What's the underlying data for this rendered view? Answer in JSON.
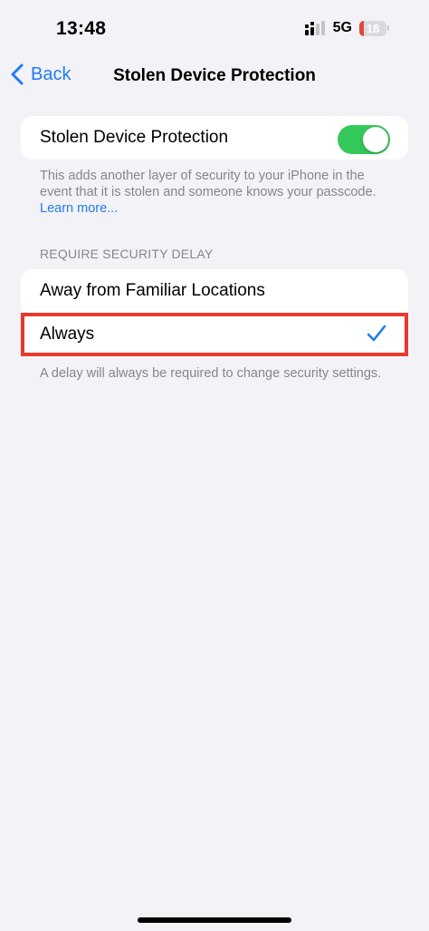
{
  "status_bar": {
    "time": "13:48",
    "network": "5G",
    "battery_level": "18",
    "battery_fraction": 0.18,
    "signal_icon": "signal-bars-icon"
  },
  "nav": {
    "back_label": "Back",
    "title": "Stolen Device Protection"
  },
  "protection": {
    "toggle_label": "Stolen Device Protection",
    "toggle_on": true,
    "description": "This adds another layer of security to your iPhone in the event that it is stolen and someone knows your passcode.",
    "learn_more": "Learn more..."
  },
  "delay": {
    "header": "REQUIRE SECURITY DELAY",
    "options": [
      {
        "label": "Away from Familiar Locations",
        "selected": false
      },
      {
        "label": "Always",
        "selected": true
      }
    ],
    "footer": "A delay will always be required to change security settings."
  },
  "colors": {
    "accent": "#1e7cf2",
    "toggle_on": "#34c759",
    "highlight": "#e8392d",
    "background": "#f2f2f7"
  }
}
